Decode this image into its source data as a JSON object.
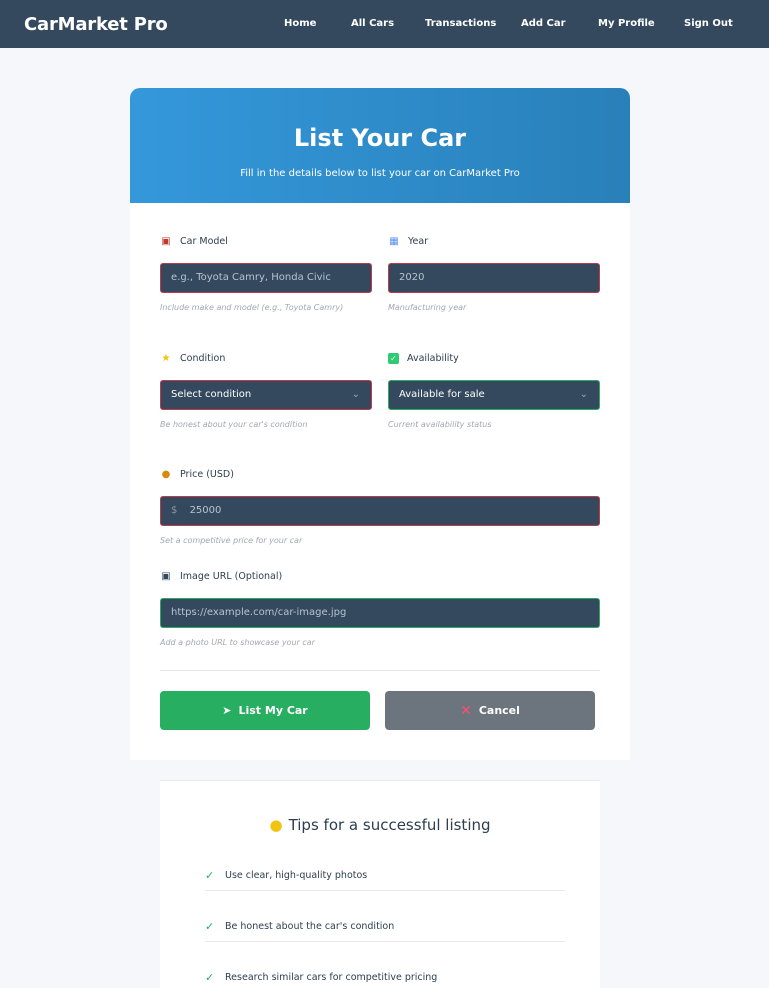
{
  "navbar": {
    "brand": "CarMarket Pro",
    "links": [
      "Home",
      "All Cars",
      "Transactions",
      "Add Car",
      "My Profile",
      "Sign Out"
    ]
  },
  "form": {
    "title": "List Your Car",
    "subtitle": "Fill in the details below to list your car on CarMarket Pro",
    "car_model": {
      "label": "Car Model",
      "icon": "car-icon",
      "placeholder": "e.g., Toyota Camry, Honda Civic",
      "hint": "Include make and model (e.g., Toyota Camry)"
    },
    "year": {
      "label": "Year",
      "icon": "calendar-icon",
      "value": "2020",
      "hint": "Manufacturing year"
    },
    "condition": {
      "label": "Condition",
      "icon": "star-icon",
      "value": "Select condition",
      "hint": "Be honest about your car's condition"
    },
    "availability": {
      "label": "Availability",
      "icon": "checkbox-icon",
      "value": "Available for sale",
      "hint": "Current availability status"
    },
    "price": {
      "label": "Price (USD)",
      "icon": "money-bag-icon",
      "currency": "$",
      "value": "25000",
      "hint": "Set a competitive price for your car"
    },
    "image_url": {
      "label": "Image URL (Optional)",
      "icon": "camera-icon",
      "placeholder": "https://example.com/car-image.jpg",
      "hint": "Add a photo URL to showcase your car"
    },
    "submit_label": "List My Car",
    "cancel_label": "Cancel"
  },
  "tips": {
    "title": "Tips for a successful listing",
    "items": [
      "Use clear, high-quality photos",
      "Be honest about the car's condition",
      "Research similar cars for competitive pricing"
    ]
  },
  "colors": {
    "navbar": "#34495e",
    "header_gradient_start": "#3498db",
    "header_gradient_end": "#2980b9",
    "primary_button": "#27ae60",
    "cancel_button": "#6c757d",
    "invalid_border": "#c0394b",
    "valid_border": "#27ae60"
  }
}
